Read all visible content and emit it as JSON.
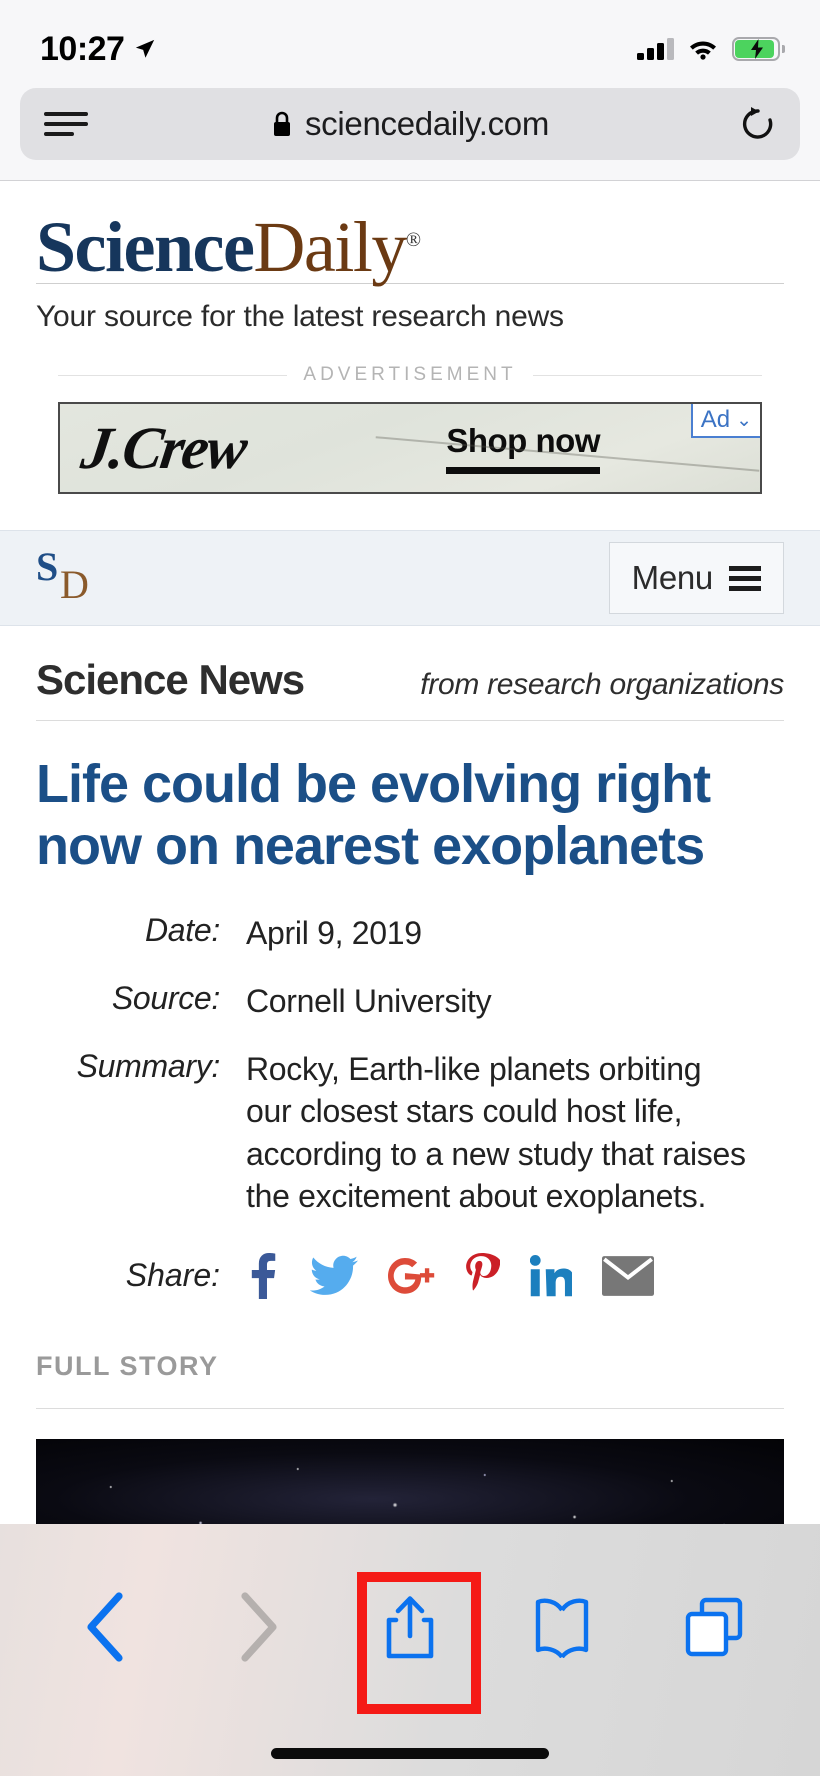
{
  "status_bar": {
    "time": "10:27",
    "location_icon": "location-arrow-icon",
    "signal_icon": "cellular-signal-icon",
    "signal_bars_filled": 3,
    "signal_bars_total": 4,
    "wifi_icon": "wifi-icon",
    "battery_icon": "battery-charging-icon",
    "battery_charging": true
  },
  "browser": {
    "menu_icon": "reader-menu-icon",
    "lock_icon": "lock-icon",
    "url": "sciencedaily.com",
    "reload_icon": "reload-icon",
    "toolbar": {
      "back_label": "back-chevron-icon",
      "forward_label": "forward-chevron-icon",
      "share_label": "share-icon",
      "bookmarks_label": "book-icon",
      "tabs_label": "tabs-icon",
      "highlight_color": "#f51a16",
      "enabled_color": "#0b72ef",
      "disabled_color": "#a8a8a8"
    }
  },
  "site": {
    "logo_part1": "Science",
    "logo_part2": "Daily",
    "logo_trademark": "®",
    "logo_color_1": "#16365c",
    "logo_color_2": "#6b3a13",
    "tagline": "Your source for the latest research news"
  },
  "advertisement": {
    "label": "ADVERTISEMENT",
    "brand": "J.Crew",
    "cta": "Shop now",
    "badge_label": "Ad",
    "badge_chevron": "⌄",
    "badge_color": "#3b73c4"
  },
  "sdnav": {
    "logo_s": "S",
    "logo_d": "D",
    "menu_label": "Menu",
    "menu_icon": "hamburger-icon"
  },
  "article": {
    "section_title": "Science News",
    "section_subtitle": "from research organizations",
    "headline": "Life could be evolving right now on nearest exoplanets",
    "headline_color": "#1b4f87",
    "meta": [
      {
        "key": "Date:",
        "value": "April 9, 2019"
      },
      {
        "key": "Source:",
        "value": "Cornell University"
      },
      {
        "key": "Summary:",
        "value": "Rocky, Earth-like planets orbiting our closest stars could host life, according to a new study that raises the excitement about exoplanets."
      }
    ],
    "share_label": "Share:",
    "share_items": [
      {
        "name": "facebook-icon",
        "color": "#3b5998"
      },
      {
        "name": "twitter-icon",
        "color": "#55acee"
      },
      {
        "name": "googleplus-icon",
        "color": "#dd4b39"
      },
      {
        "name": "pinterest-icon",
        "color": "#cb2027"
      },
      {
        "name": "linkedin-icon",
        "color": "#1c7fbe"
      },
      {
        "name": "email-icon",
        "color": "#777777"
      }
    ],
    "full_story_label": "FULL STORY"
  }
}
